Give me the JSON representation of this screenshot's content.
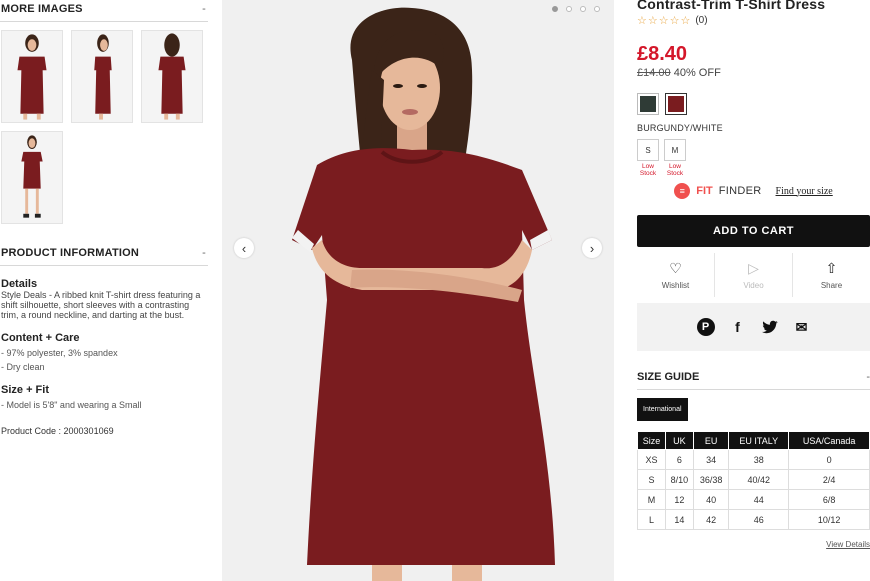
{
  "left": {
    "more_images_title": "MORE IMAGES",
    "more_images_toggle": "-",
    "product_info_title": "PRODUCT INFORMATION",
    "product_info_toggle": "-",
    "details_heading": "Details",
    "details_brand": "Style Deals",
    "details_text": " - A ribbed knit T-shirt dress featuring a shift silhouette, short sleeves with a contrasting trim, a round neckline, and darting at the bust.",
    "content_heading": "Content + Care",
    "content_items": [
      "- 97% polyester, 3% spandex",
      "- Dry clean"
    ],
    "fit_heading": "Size + Fit",
    "fit_items": [
      "- Model is 5'8\" and wearing a Small"
    ],
    "product_code": "Product Code : 2000301069"
  },
  "gallery": {
    "prev_icon": "‹",
    "next_icon": "›",
    "dot_count": 4,
    "active_dot": 0,
    "dress_color": "#7a1c1f",
    "skin_color": "#e6b89a",
    "hair_color": "#3b2418"
  },
  "product": {
    "title": "Contrast-Trim T-Shirt Dress",
    "stars": "☆☆☆☆☆",
    "review_count": "(0)",
    "price": "£8.40",
    "original_price": "£14.00",
    "discount": "40% OFF",
    "price_color": "#d4172a",
    "swatches": [
      {
        "color": "#2f3b36",
        "selected": false
      },
      {
        "color": "#7a1c1f",
        "selected": true
      }
    ],
    "color_name": "BURGUNDY/WHITE",
    "sizes": [
      {
        "label": "S",
        "stock": "Low Stock"
      },
      {
        "label": "M",
        "stock": "Low Stock"
      }
    ],
    "fit_brand": "FIT",
    "fit_finder": "FINDER",
    "fit_link": "Find your size",
    "add_to_cart": "ADD TO CART",
    "actions": {
      "wishlist": "Wishlist",
      "video": "Video",
      "share": "Share"
    }
  },
  "size_guide": {
    "title": "SIZE GUIDE",
    "toggle": "-",
    "tab": "International",
    "headers": [
      "Size",
      "UK",
      "EU",
      "EU ITALY",
      "USA/Canada"
    ],
    "rows": [
      [
        "XS",
        "6",
        "34",
        "38",
        "0"
      ],
      [
        "S",
        "8/10",
        "36/38",
        "40/42",
        "2/4"
      ],
      [
        "M",
        "12",
        "40",
        "44",
        "6/8"
      ],
      [
        "L",
        "14",
        "42",
        "46",
        "10/12"
      ]
    ],
    "view_details": "View Details"
  }
}
